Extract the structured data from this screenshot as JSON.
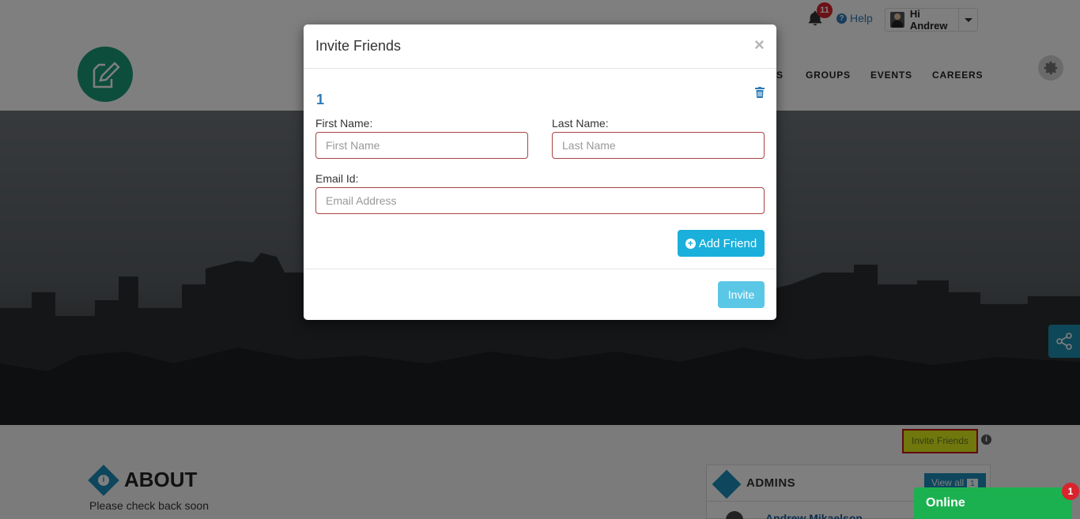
{
  "topbar": {
    "notification_count": "11",
    "help_label": "Help",
    "user_greeting": "Hi Andrew"
  },
  "nav": {
    "items": [
      "S",
      "GROUPS",
      "EVENTS",
      "CAREERS"
    ]
  },
  "page": {
    "invite_friends_button": "Invite Friends",
    "about_title": "ABOUT",
    "about_text": "Please check back soon",
    "admins_title": "ADMINS",
    "view_all_label": "View all",
    "view_all_count": "1",
    "admin_name": "Andrew Mikaelson",
    "online_label": "Online",
    "online_badge": "1"
  },
  "modal": {
    "title": "Invite Friends",
    "close_symbol": "×",
    "friend_index": "1",
    "first_name_label": "First Name:",
    "first_name_placeholder": "First Name",
    "first_name_value": "",
    "last_name_label": "Last Name:",
    "last_name_placeholder": "Last Name",
    "last_name_value": "",
    "email_label": "Email Id:",
    "email_placeholder": "Email Address",
    "email_value": "",
    "add_friend_label": "Add Friend",
    "invite_label": "Invite"
  },
  "colors": {
    "accent_blue": "#1ab0db",
    "error_border": "#a94442",
    "online_green": "#1cb150",
    "badge_red": "#d9232d",
    "logo_green": "#1a9a77"
  },
  "icons": [
    "bell-icon",
    "help-icon",
    "user-avatar",
    "caret-down-icon",
    "logo-edit-icon",
    "gear-icon",
    "share-icon",
    "info-icon",
    "close-icon",
    "trash-icon",
    "plus-circle-icon"
  ]
}
